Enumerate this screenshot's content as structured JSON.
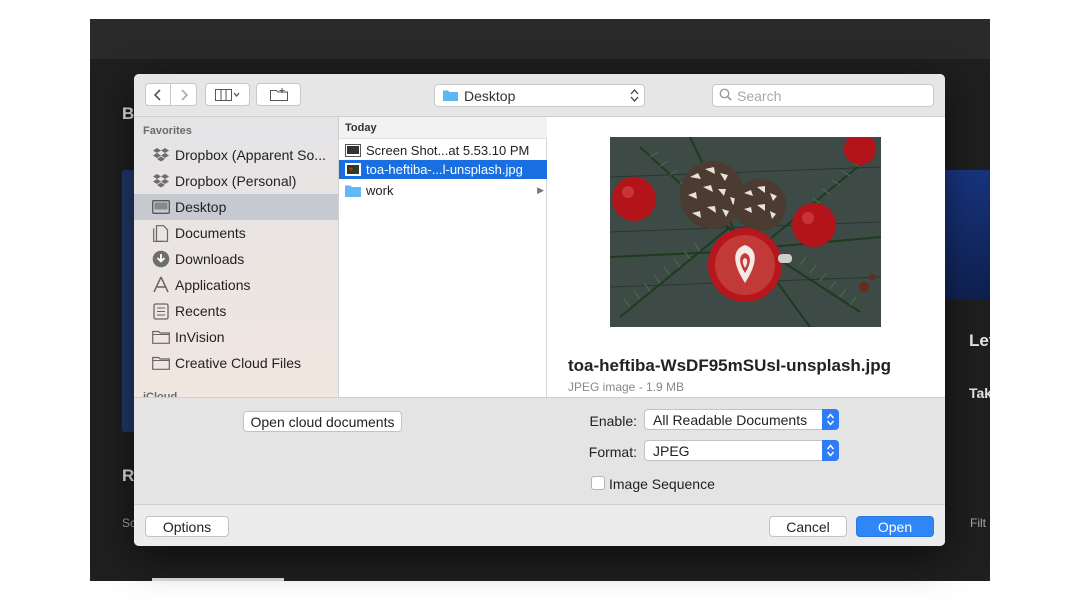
{
  "background_app": {
    "colors": {
      "bg": "#1f1f1f",
      "titlebar": "#2a2a2a"
    },
    "fragments": {
      "left_b": "B",
      "left_r": "R",
      "left_sc": "Sc",
      "right_let": "Let",
      "right_tak": "Tak",
      "right_filt": "Filt"
    }
  },
  "dialog": {
    "toolbar": {
      "back_icon": "chevron-left-icon",
      "forward_icon": "chevron-right-icon",
      "view_icon": "column-view-icon",
      "new_folder_icon": "new-folder-icon",
      "location": "Desktop",
      "search_placeholder": "Search"
    },
    "sidebar": {
      "heading": "Favorites",
      "items": [
        {
          "label": "Dropbox (Apparent So...",
          "icon": "dropbox-icon",
          "selected": false
        },
        {
          "label": "Dropbox (Personal)",
          "icon": "dropbox-icon",
          "selected": false
        },
        {
          "label": "Desktop",
          "icon": "desktop-icon",
          "selected": true
        },
        {
          "label": "Documents",
          "icon": "documents-icon",
          "selected": false
        },
        {
          "label": "Downloads",
          "icon": "downloads-icon",
          "selected": false
        },
        {
          "label": "Applications",
          "icon": "applications-icon",
          "selected": false
        },
        {
          "label": "Recents",
          "icon": "recents-icon",
          "selected": false
        },
        {
          "label": "InVision",
          "icon": "folder-icon",
          "selected": false
        },
        {
          "label": "Creative Cloud Files",
          "icon": "folder-icon",
          "selected": false
        }
      ],
      "cut_heading": "iCloud"
    },
    "file_list": {
      "header": "Today",
      "rows": [
        {
          "name": "Screen Shot...at 5.53.10 PM",
          "icon": "screenshot-icon",
          "selected": false,
          "has_children": false
        },
        {
          "name": "toa-heftiba-...l-unsplash.jpg",
          "icon": "image-file-icon",
          "selected": true,
          "has_children": false
        },
        {
          "name": "work",
          "icon": "folder-icon",
          "selected": false,
          "has_children": true
        }
      ]
    },
    "preview": {
      "filename": "toa-heftiba-WsDF95mSUsI-unsplash.jpg",
      "meta": "JPEG image - 1.9 MB"
    },
    "options": {
      "cloud_button": "Open cloud documents",
      "enable_label": "Enable:",
      "enable_value": "All Readable Documents",
      "format_label": "Format:",
      "format_value": "JPEG",
      "image_sequence_label": "Image Sequence",
      "image_sequence_checked": false
    },
    "footer": {
      "options_button": "Options",
      "cancel_button": "Cancel",
      "open_button": "Open"
    },
    "colors": {
      "accent": "#2f86f7",
      "selection": "#1a6fe0",
      "sidebar_selection": "#c6c9cf"
    }
  }
}
